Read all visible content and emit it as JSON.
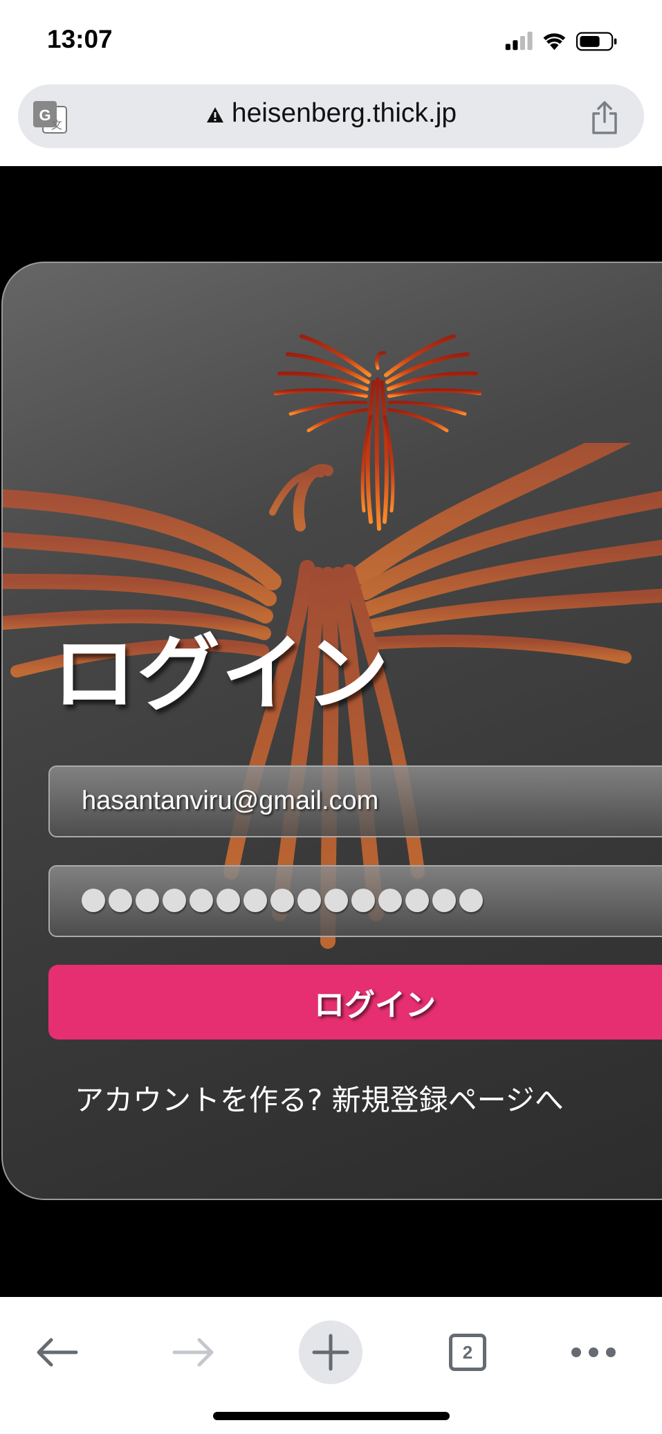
{
  "status_bar": {
    "time": "13:07"
  },
  "browser": {
    "url": "heisenberg.thick.jp",
    "insecure_icon": "warning-triangle-icon",
    "translate_icon": "translate-icon",
    "share_icon": "share-icon"
  },
  "login": {
    "title": "ログイン",
    "email_value": "hasantanviru@gmail.com",
    "password_length": 15,
    "button_label": "ログイン",
    "signup_link": "アカウントを作る? 新規登録ページへ"
  },
  "toolbar": {
    "tab_count": "2",
    "icons": [
      "back-icon",
      "forward-icon",
      "new-tab-icon",
      "tabs-icon",
      "more-icon"
    ]
  },
  "colors": {
    "accent": "#e62f70",
    "phoenix_orange": "#e8612a"
  }
}
